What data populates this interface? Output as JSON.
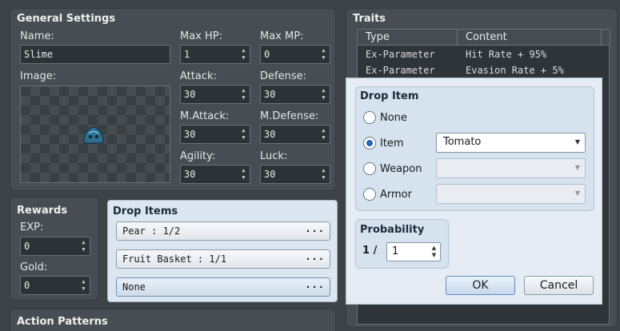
{
  "general": {
    "title": "General Settings",
    "name_label": "Name:",
    "name_value": "Slime",
    "image_label": "Image:",
    "maxhp_label": "Max HP:",
    "maxhp_value": "1",
    "maxmp_label": "Max MP:",
    "maxmp_value": "0",
    "attack_label": "Attack:",
    "attack_value": "30",
    "defense_label": "Defense:",
    "defense_value": "30",
    "mattack_label": "M.Attack:",
    "mattack_value": "30",
    "mdefense_label": "M.Defense:",
    "mdefense_value": "30",
    "agility_label": "Agility:",
    "agility_value": "30",
    "luck_label": "Luck:",
    "luck_value": "30"
  },
  "traits": {
    "title": "Traits",
    "col_type": "Type",
    "col_content": "Content",
    "rows": [
      {
        "type": "Ex-Parameter",
        "content": "Hit Rate + 95%"
      },
      {
        "type": "Ex-Parameter",
        "content": "Evasion Rate + 5%"
      }
    ]
  },
  "rewards": {
    "title": "Rewards",
    "exp_label": "EXP:",
    "exp_value": "0",
    "gold_label": "Gold:",
    "gold_value": "0"
  },
  "drop_items": {
    "title": "Drop Items",
    "items": [
      "Pear : 1/2",
      "Fruit Basket : 1/1",
      "None"
    ],
    "more": "···"
  },
  "action_patterns": {
    "title": "Action Patterns"
  },
  "dialog": {
    "group_title": "Drop Item",
    "options": {
      "none": "None",
      "item": "Item",
      "weapon": "Weapon",
      "armor": "Armor"
    },
    "selected_option": "item",
    "item_value": "Tomato",
    "weapon_value": "",
    "armor_value": "",
    "probability_title": "Probability",
    "probability_prefix": "1 /",
    "probability_value": "1",
    "ok_label": "OK",
    "cancel_label": "Cancel"
  },
  "icons": {
    "spin_up": "▲",
    "spin_down": "▼",
    "combo_caret": "▼"
  },
  "colors": {
    "background": "#3d4347",
    "panel": "#474d52",
    "highlight_panel": "#dbe6f1",
    "radio_check": "#2b63b5"
  }
}
